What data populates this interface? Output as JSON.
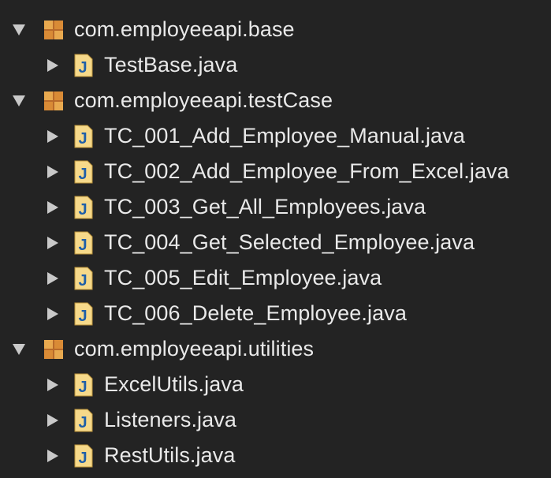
{
  "tree": {
    "packages": [
      {
        "name": "com.employeeapi.base",
        "expanded": true,
        "files": [
          {
            "name": "TestBase.java"
          }
        ]
      },
      {
        "name": "com.employeeapi.testCase",
        "expanded": true,
        "files": [
          {
            "name": "TC_001_Add_Employee_Manual.java"
          },
          {
            "name": "TC_002_Add_Employee_From_Excel.java"
          },
          {
            "name": "TC_003_Get_All_Employees.java"
          },
          {
            "name": "TC_004_Get_Selected_Employee.java"
          },
          {
            "name": "TC_005_Edit_Employee.java"
          },
          {
            "name": "TC_006_Delete_Employee.java"
          }
        ]
      },
      {
        "name": "com.employeeapi.utilities",
        "expanded": true,
        "files": [
          {
            "name": "ExcelUtils.java"
          },
          {
            "name": "Listeners.java"
          },
          {
            "name": "RestUtils.java"
          }
        ]
      }
    ]
  },
  "icons": {
    "package": "package-icon",
    "java_file": "java-file-icon",
    "expanded": "expanded-arrow-icon",
    "collapsed": "collapsed-arrow-icon"
  },
  "colors": {
    "background": "#232323",
    "text": "#e9e9e9",
    "arrow": "#c9c9c9",
    "package_icon": "#e2a04a",
    "java_icon_fill": "#f4d27a",
    "java_icon_letter": "#1f5fa8"
  }
}
